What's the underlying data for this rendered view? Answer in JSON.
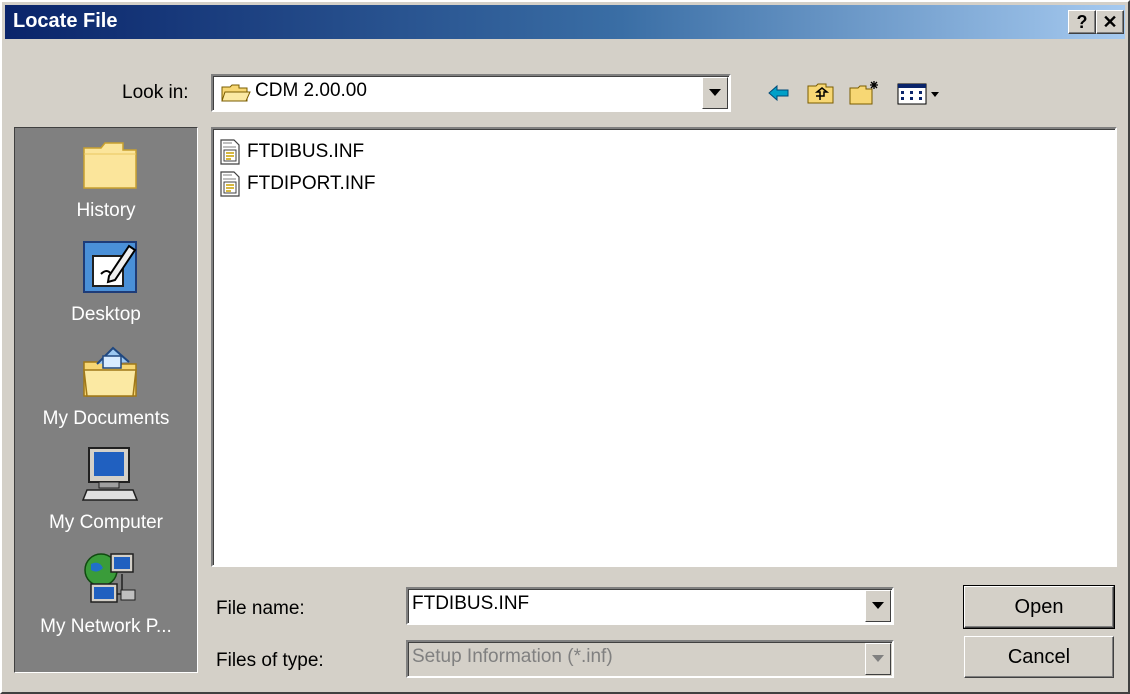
{
  "window": {
    "title": "Locate File",
    "help_label": "?",
    "close_label": "✕"
  },
  "look_in": {
    "label": "Look in:",
    "value": "CDM 2.00.00"
  },
  "toolbar": {
    "icons": [
      "back-icon",
      "up-folder-icon",
      "new-folder-icon",
      "view-menu-icon"
    ]
  },
  "places": [
    {
      "label": "History",
      "icon": "history-folder-icon"
    },
    {
      "label": "Desktop",
      "icon": "desktop-icon"
    },
    {
      "label": "My Documents",
      "icon": "my-documents-icon"
    },
    {
      "label": "My Computer",
      "icon": "my-computer-icon"
    },
    {
      "label": "My Network P...",
      "icon": "my-network-places-icon"
    }
  ],
  "files": [
    {
      "name": "FTDIBUS.INF",
      "icon": "inf-file-icon"
    },
    {
      "name": "FTDIPORT.INF",
      "icon": "inf-file-icon"
    }
  ],
  "file_name": {
    "label": "File name:",
    "value": "FTDIBUS.INF"
  },
  "file_type": {
    "label": "Files of type:",
    "value": "Setup Information (*.inf)"
  },
  "buttons": {
    "open": "Open",
    "cancel": "Cancel"
  },
  "colors": {
    "title_gradient_start": "#0a246a",
    "title_gradient_end": "#a6caf0",
    "face": "#d4d0c8",
    "places_bar": "#808080"
  }
}
